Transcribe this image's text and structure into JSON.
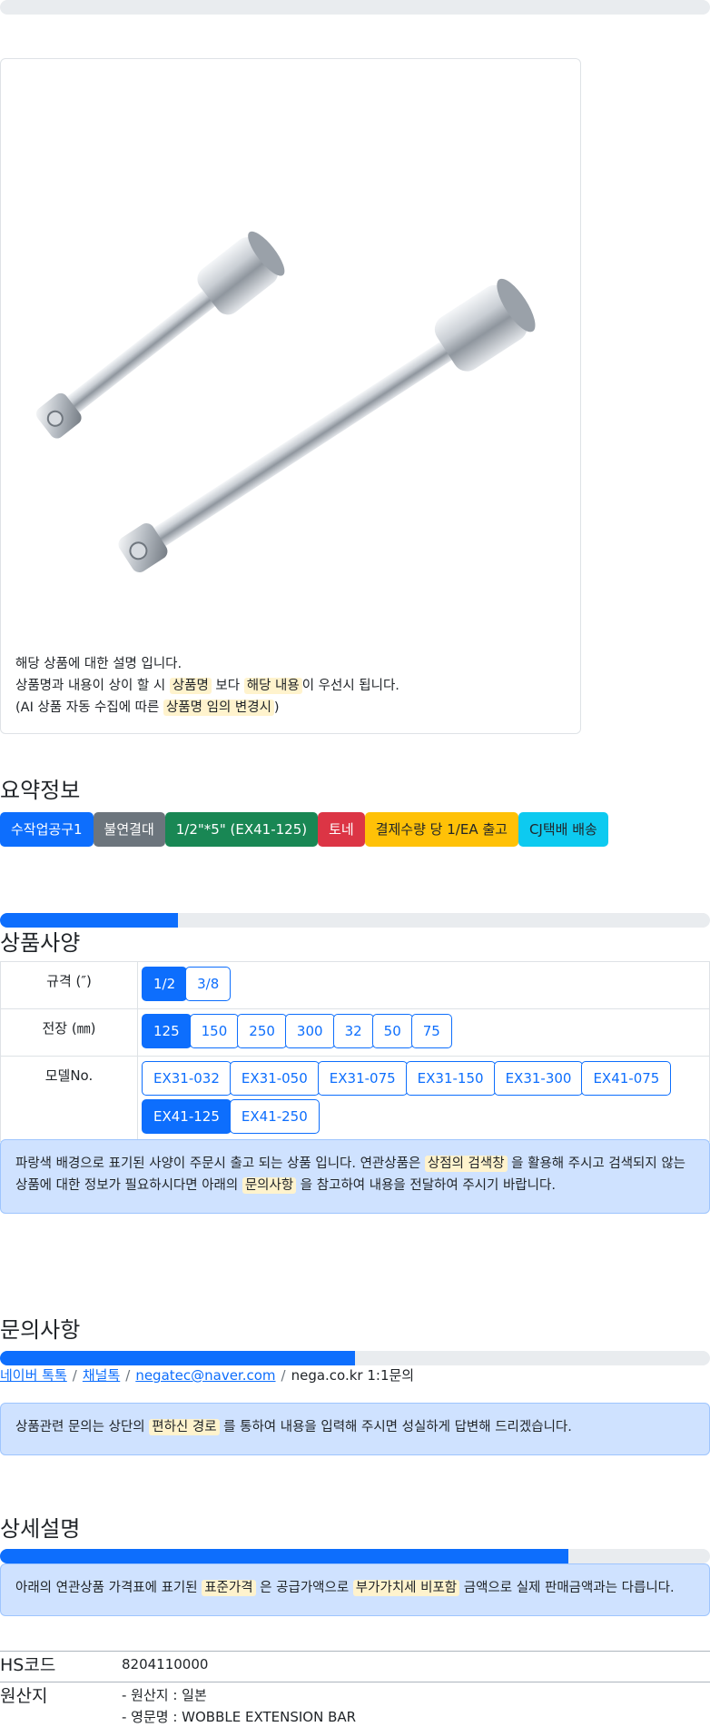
{
  "top_progress": {
    "percent": 0
  },
  "product_image": {
    "notes": {
      "line1": "해당 상품에 대한 설명 입니다.",
      "line2_pre": "상품명과 내용이 상이 할 시 ",
      "line2_hl1": "상품명",
      "line2_mid": " 보다 ",
      "line2_hl2": "해당 내용",
      "line2_post": "이 우선시 됩니다.",
      "line3_pre": "(AI 상품 자동 수집에 따른 ",
      "line3_hl": "상품명 임의 변경시",
      "line3_post": ")"
    }
  },
  "summary": {
    "title": "요약정보",
    "badges": [
      {
        "label": "수작업공구1",
        "color": "#0d6efd"
      },
      {
        "label": "불연결대",
        "color": "#6c757d"
      },
      {
        "label": "1/2\"*5\" (EX41-125)",
        "color": "#198754"
      },
      {
        "label": "토네",
        "color": "#dc3545"
      },
      {
        "label": "결제수량 당 1/EA 출고",
        "color": "#ffc107"
      },
      {
        "label": "CJ택배 배송",
        "color": "#0dcaf0"
      }
    ]
  },
  "specs": {
    "progress_percent": 25,
    "title": "상품사양",
    "rows": [
      {
        "label": "규격 (″)",
        "options": [
          "1/2",
          "3/8"
        ],
        "selected": "1/2"
      },
      {
        "label": "전장 (㎜)",
        "options": [
          "125",
          "150",
          "250",
          "300",
          "32",
          "50",
          "75"
        ],
        "selected": "125"
      },
      {
        "label": "모델No.",
        "options": [
          "EX31-032",
          "EX31-050",
          "EX31-075",
          "EX31-150",
          "EX31-300",
          "EX41-075",
          "EX41-125",
          "EX41-250"
        ],
        "selected": "EX41-125"
      }
    ],
    "notice": {
      "pre": "파랑색 배경으로 표기된 사양이 주문시 출고 되는 상품 입니다. 연관상품은 ",
      "hl1": "상점의 검색창",
      "mid": " 을 활용해 주시고 검색되지 않는 상품에 대한 정보가 필요하시다면 아래의 ",
      "hl2": "문의사항",
      "post": " 을 참고하여 내용을 전달하여 주시기 바랍니다."
    }
  },
  "inquiry": {
    "title": "문의사항",
    "progress_percent": 50,
    "links": [
      "네이버 톡톡",
      "채널톡",
      "negatec@naver.com"
    ],
    "last": "nega.co.kr 1:1문의",
    "notice": {
      "pre": "상품관련 문의는 상단의 ",
      "hl": "편하신 경로",
      "post": " 를 통하여 내용을 입력해 주시면 성실하게 답변해 드리겠습니다."
    }
  },
  "detail": {
    "title": "상세설명",
    "progress_percent": 80,
    "notice": {
      "pre": "아래의 연관상품 가격표에 표기된 ",
      "hl1": "표준가격",
      "mid": " 은 공급가액으로 ",
      "hl2": "부가가치세 비포함",
      "post": " 금액으로 실제 판매금액과는 다릅니다."
    },
    "info": [
      {
        "key": "HS코드",
        "values": [
          "8204110000"
        ]
      },
      {
        "key": "원산지",
        "values": [
          "- 원산지 : 일본",
          "- 영문명 : WOBBLE EXTENSION BAR"
        ]
      }
    ]
  }
}
